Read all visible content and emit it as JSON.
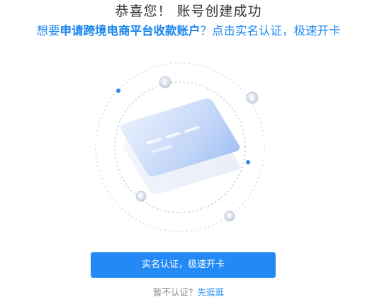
{
  "header": {
    "title": "恭喜您！ 账号创建成功",
    "subtitle_prefix": "想要",
    "subtitle_highlight": "申请跨境电商平台收款账户",
    "subtitle_suffix": "？点击实名认证，极速开卡"
  },
  "illustration": {
    "coins": {
      "pound": "£",
      "dollar": "$",
      "euro": "€",
      "yen": "¥"
    }
  },
  "actions": {
    "primary_label": "实名认证，极速开卡",
    "skip_question": "暂不认证？",
    "skip_link": "先逛逛"
  },
  "colors": {
    "accent": "#2389f5",
    "text_dark": "#333333",
    "text_muted": "#888888",
    "card_light": "#dfe9fb",
    "card_mid": "#a9c4f4"
  }
}
